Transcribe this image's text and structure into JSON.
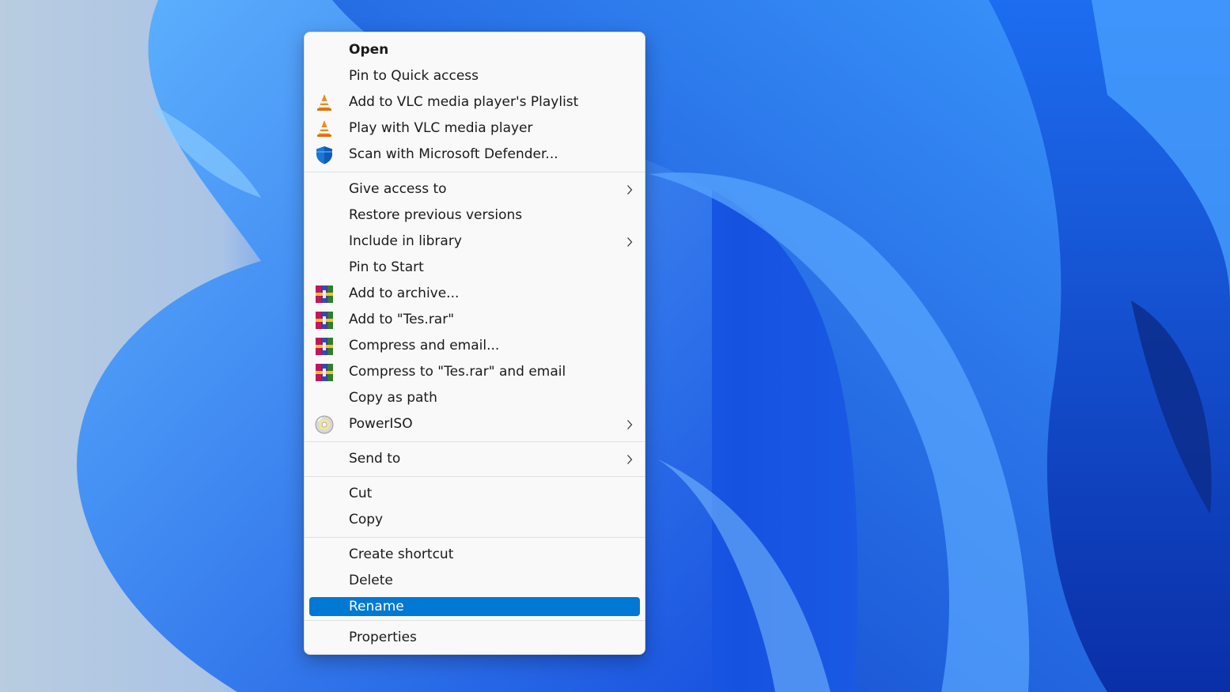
{
  "context_menu": {
    "groups": [
      [
        {
          "label": "Open",
          "bold": true
        },
        {
          "label": "Pin to Quick access"
        },
        {
          "label": "Add to VLC media player's Playlist",
          "icon": "vlc-icon"
        },
        {
          "label": "Play with VLC media player",
          "icon": "vlc-icon"
        },
        {
          "label": "Scan with Microsoft Defender...",
          "icon": "defender-shield-icon"
        }
      ],
      [
        {
          "label": "Give access to",
          "submenu": true
        },
        {
          "label": "Restore previous versions"
        },
        {
          "label": "Include in library",
          "submenu": true
        },
        {
          "label": "Pin to Start"
        },
        {
          "label": "Add to archive...",
          "icon": "winrar-icon"
        },
        {
          "label": "Add to \"Tes.rar\"",
          "icon": "winrar-icon"
        },
        {
          "label": "Compress and email...",
          "icon": "winrar-icon"
        },
        {
          "label": "Compress to \"Tes.rar\" and email",
          "icon": "winrar-icon"
        },
        {
          "label": "Copy as path"
        },
        {
          "label": "PowerISO",
          "icon": "poweriso-disc-icon",
          "submenu": true
        }
      ],
      [
        {
          "label": "Send to",
          "submenu": true
        }
      ],
      [
        {
          "label": "Cut"
        },
        {
          "label": "Copy"
        }
      ],
      [
        {
          "label": "Create shortcut"
        },
        {
          "label": "Delete"
        },
        {
          "label": "Rename",
          "selected": true
        }
      ],
      [
        {
          "label": "Properties"
        }
      ]
    ]
  },
  "colors": {
    "selection": "#0078d4",
    "menu_background": "#f9f9f9",
    "wallpaper_primary": "#1a5fe0",
    "wallpaper_light": "#b9cce0"
  }
}
